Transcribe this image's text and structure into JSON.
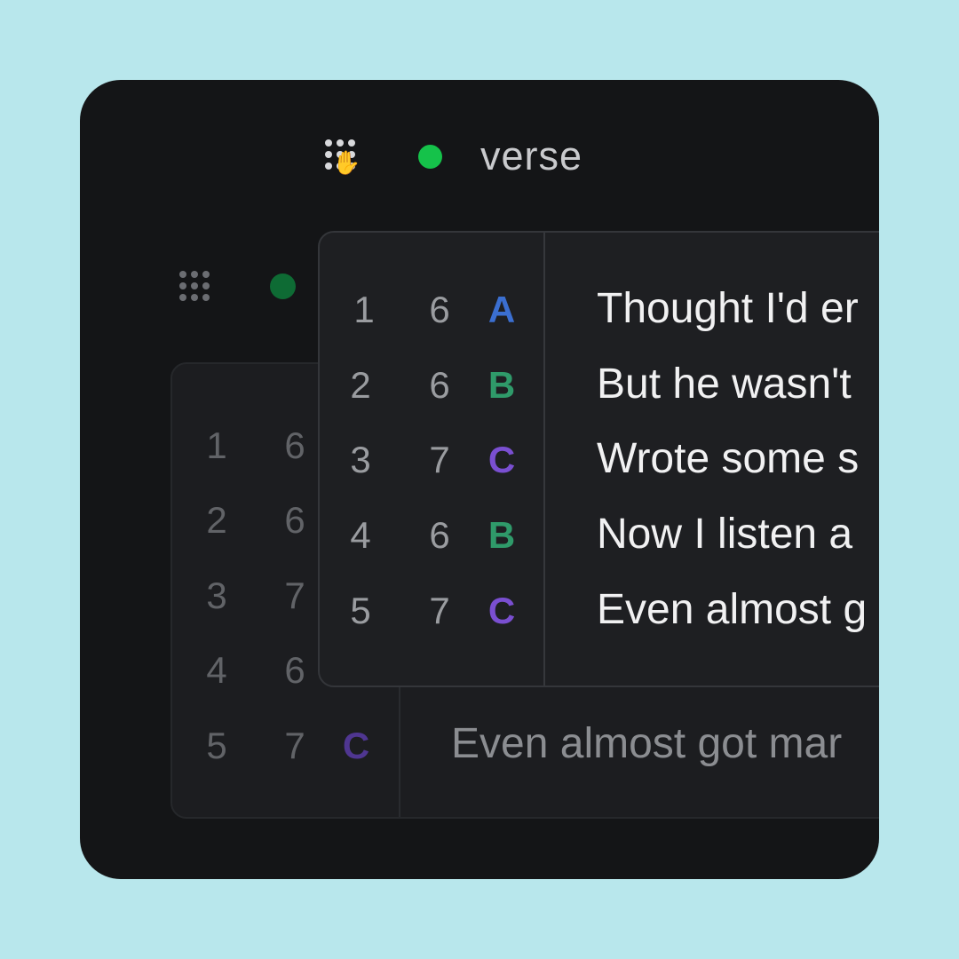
{
  "header": {
    "title": "verse",
    "status_color": "#15c24a"
  },
  "colors": {
    "A": "#3b6fd1",
    "B": "#2f9a6a",
    "C": "#7a4fd1"
  },
  "back_panel": {
    "rows": [
      {
        "line": "1",
        "syllables": "6",
        "rhyme": "",
        "lyric": ""
      },
      {
        "line": "2",
        "syllables": "6",
        "rhyme": "",
        "lyric": ""
      },
      {
        "line": "3",
        "syllables": "7",
        "rhyme": "",
        "lyric": ""
      },
      {
        "line": "4",
        "syllables": "6",
        "rhyme": "",
        "lyric": ""
      },
      {
        "line": "5",
        "syllables": "7",
        "rhyme": "C",
        "lyric": "Even almost got mar"
      }
    ]
  },
  "front_panel": {
    "rows": [
      {
        "line": "1",
        "syllables": "6",
        "rhyme": "A",
        "lyric": "Thought I'd er"
      },
      {
        "line": "2",
        "syllables": "6",
        "rhyme": "B",
        "lyric": "But he wasn't"
      },
      {
        "line": "3",
        "syllables": "7",
        "rhyme": "C",
        "lyric": "Wrote some s"
      },
      {
        "line": "4",
        "syllables": "6",
        "rhyme": "B",
        "lyric": "Now I listen a"
      },
      {
        "line": "5",
        "syllables": "7",
        "rhyme": "C",
        "lyric": "Even almost g"
      }
    ]
  },
  "cursor_icon": "grab-hand-icon"
}
